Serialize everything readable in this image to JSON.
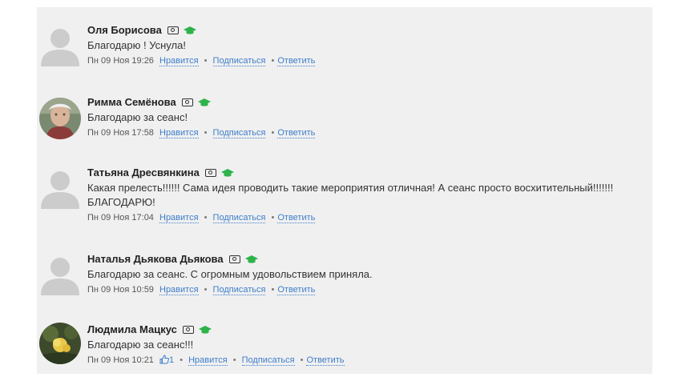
{
  "labels": {
    "like": "Нравится",
    "subscribe": "Подписаться",
    "reply": "Ответить"
  },
  "comments": [
    {
      "author": "Оля Борисова",
      "text": "Благодарю ! Уснула!",
      "time": "Пн 09 Ноя 19:26",
      "avatar": "placeholder"
    },
    {
      "author": "Римма Семёнова",
      "text": "Благодарю за сеанс!",
      "time": "Пн 09 Ноя 17:58",
      "avatar": "photo"
    },
    {
      "author": "Татьяна Дресвянкина",
      "text": "Какая прелесть!!!!!! Сама идея проводить такие мероприятия отличная! А сеанс просто восхитительный!!!!!!! БЛАГОДАРЮ!",
      "time": "Пн 09 Ноя 17:04",
      "avatar": "placeholder"
    },
    {
      "author": "Наталья Дьякова Дьякова",
      "text": "Благодарю за сеанс. С огромным удовольствием приняла.",
      "time": "Пн 09 Ноя 10:59",
      "avatar": "placeholder"
    },
    {
      "author": "Людмила Мацкус",
      "text": "Благодарю за сеанс!!!",
      "time": "Пн 09 Ноя 10:21",
      "avatar": "photo",
      "likes": "1"
    }
  ],
  "colors": {
    "panel_bg": "#f0f0f0",
    "link": "#3e7ecb",
    "cap_icon": "#2db34a",
    "avatar_placeholder": "#cccccc"
  },
  "icons": [
    "id-badge-icon",
    "graduation-cap-icon",
    "thumbs-up-icon",
    "user-placeholder-icon"
  ]
}
